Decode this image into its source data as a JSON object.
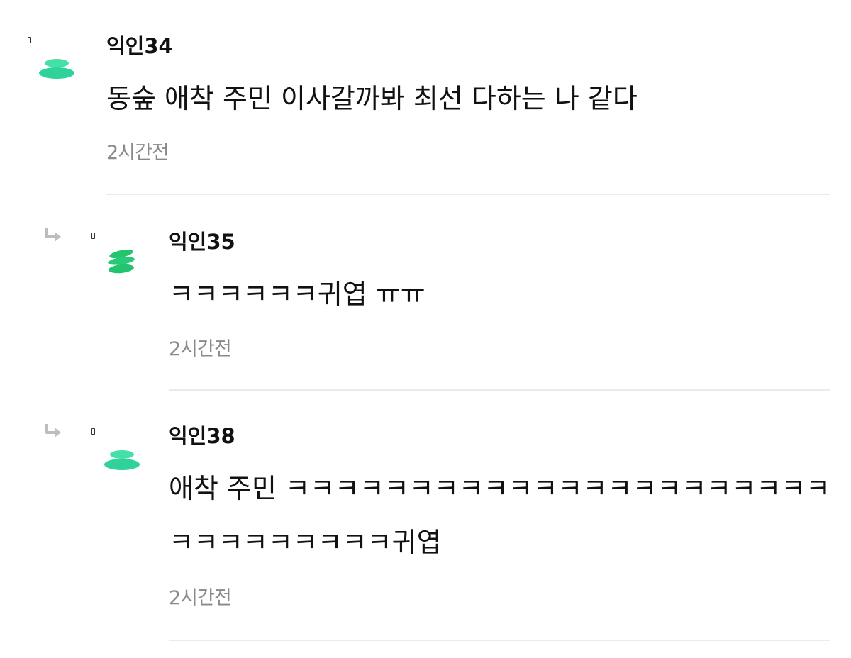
{
  "comments": [
    {
      "author": "익인34",
      "lines": [
        "동숲 애착 주민 이사갈까봐 최선 다하는 나 같다"
      ],
      "time": "2시간전"
    },
    {
      "author": "익인35",
      "lines": [
        "ㅋㅋㅋㅋㅋㅋ귀엽 ㅠㅠ"
      ],
      "time": "2시간전"
    },
    {
      "author": "익인38",
      "lines": [
        "애착 주민 ㅋㅋㅋㅋㅋㅋㅋㅋㅋㅋㅋㅋㅋㅋㅋㅋㅋㅋㅋㅋㅋㅋ",
        "ㅋㅋㅋㅋㅋㅋㅋㅋㅋ귀엽"
      ],
      "time": "2시간전"
    }
  ],
  "colors": {
    "avatar_green": "#2fd39a",
    "avatar_green_alt": "#22c46e",
    "reply_arrow": "#bdbdbd",
    "divider": "#ebebeb",
    "time_text": "#8a8a8a"
  },
  "icons": {
    "reply": "reply-arrow-icon",
    "avatar": "avatar-icon",
    "missing_glyph": "missing-glyph-icon"
  }
}
